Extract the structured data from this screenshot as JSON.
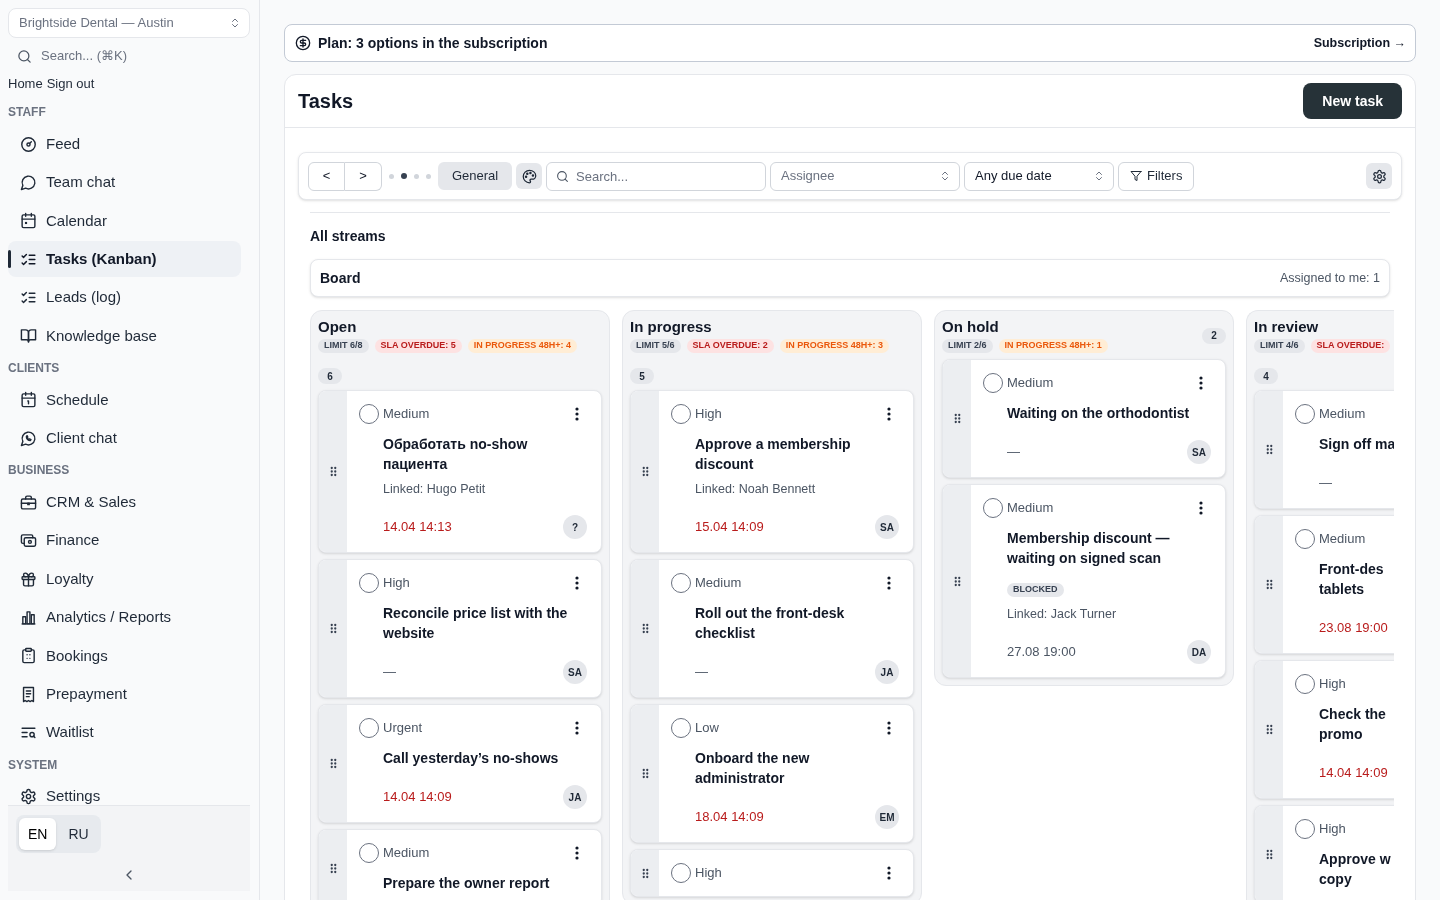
{
  "sidebar": {
    "org_select": {
      "value": "Brightside Dental — Austin"
    },
    "search": {
      "placeholder": "Search... (⌘K)"
    },
    "links": [
      "Home",
      "Sign out"
    ],
    "sections": [
      {
        "title": "STAFF",
        "items": [
          {
            "label": "Feed",
            "selected": false
          },
          {
            "label": "Team chat",
            "selected": false
          },
          {
            "label": "Calendar",
            "selected": false
          },
          {
            "label": "Tasks (Kanban)",
            "selected": true
          },
          {
            "label": "Leads (log)",
            "selected": false
          },
          {
            "label": "Knowledge base",
            "selected": false
          }
        ]
      },
      {
        "title": "CLIENTS",
        "items": [
          {
            "label": "Schedule",
            "selected": false
          },
          {
            "label": "Client chat",
            "selected": false
          }
        ]
      },
      {
        "title": "BUSINESS",
        "items": [
          {
            "label": "CRM & Sales",
            "selected": false
          },
          {
            "label": "Finance",
            "selected": false
          },
          {
            "label": "Loyalty",
            "selected": false
          },
          {
            "label": "Analytics / Reports",
            "selected": false
          },
          {
            "label": "Bookings",
            "selected": false
          },
          {
            "label": "Prepayment",
            "selected": false
          },
          {
            "label": "Waitlist",
            "selected": false
          }
        ]
      },
      {
        "title": "SYSTEM",
        "items": [
          {
            "label": "Settings",
            "selected": false
          }
        ]
      }
    ],
    "languages": [
      {
        "label": "EN",
        "selected": true
      },
      {
        "label": "RU",
        "selected": false
      }
    ]
  },
  "plan_banner": {
    "text": "Plan: 3 options in the subscription",
    "link": "Subscription →"
  },
  "header": {
    "title": "Tasks",
    "new_button": "New task"
  },
  "toolbar": {
    "prev": "<",
    "next": ">",
    "pages": [
      {
        "selected": false
      },
      {
        "selected": true
      },
      {
        "selected": false
      },
      {
        "selected": false
      }
    ],
    "stream": "General",
    "search": {
      "placeholder": "Search..."
    },
    "assignee": {
      "placeholder": "Assignee"
    },
    "due_date": {
      "value": "Any due date"
    },
    "filters": "Filters"
  },
  "streams_title": "All streams",
  "board": {
    "title": "Board",
    "assigned": "Assigned to me: 1"
  },
  "columns": [
    {
      "title": "Open",
      "clipped": false,
      "badges": [
        {
          "kind": "limit",
          "text": "LIMIT 6/8"
        },
        {
          "kind": "overdue",
          "text": "SLA OVERDUE: 5"
        },
        {
          "kind": "stale",
          "text": "IN PROGRESS 48H+: 4"
        }
      ],
      "count": "6",
      "cards": [
        {
          "priority": "Medium",
          "checked": false,
          "title": "Обработать no‑show пациента",
          "linked": "Linked: Hugo Petit",
          "due": "14.04 14:13",
          "overdue": true,
          "assignee": "?"
        },
        {
          "priority": "High",
          "checked": false,
          "title": "Reconcile price list with the website",
          "due": "—",
          "overdue": false,
          "assignee": "SA"
        },
        {
          "priority": "Urgent",
          "checked": false,
          "title": "Call yesterday’s no‑shows",
          "due": "14.04 14:09",
          "overdue": true,
          "assignee": "JA"
        },
        {
          "priority": "Medium",
          "checked": false,
          "title": "Prepare the owner report"
        }
      ]
    },
    {
      "title": "In progress",
      "clipped": false,
      "badges": [
        {
          "kind": "limit",
          "text": "LIMIT 5/6"
        },
        {
          "kind": "overdue",
          "text": "SLA OVERDUE: 2"
        },
        {
          "kind": "stale",
          "text": "IN PROGRESS 48H+: 3"
        }
      ],
      "count": "5",
      "cards": [
        {
          "priority": "High",
          "checked": false,
          "title": "Approve a membership discount",
          "linked": "Linked: Noah Bennett",
          "due": "15.04 14:09",
          "overdue": true,
          "assignee": "SA"
        },
        {
          "priority": "Medium",
          "checked": false,
          "title": "Roll out the front‑desk checklist",
          "due": "—",
          "overdue": false,
          "assignee": "JA"
        },
        {
          "priority": "Low",
          "checked": false,
          "title": "Onboard the new administrator",
          "due": "18.04 14:09",
          "overdue": true,
          "assignee": "EM"
        },
        {
          "priority": "High",
          "checked": false
        }
      ]
    },
    {
      "title": "On hold",
      "clipped": false,
      "badges": [
        {
          "kind": "limit",
          "text": "LIMIT 2/6"
        },
        {
          "kind": "stale",
          "text": "IN PROGRESS 48H+: 1"
        }
      ],
      "count": "2",
      "cards": [
        {
          "priority": "Medium",
          "checked": false,
          "title": "Waiting on the orthodontist",
          "due": "—",
          "overdue": false,
          "assignee": "SA"
        },
        {
          "priority": "Medium",
          "checked": false,
          "title": "Membership discount — waiting on signed scan",
          "tag": "BLOCKED",
          "linked": "Linked: Jack Turner",
          "due": "27.08 19:00",
          "overdue": false,
          "assignee": "DA"
        }
      ]
    },
    {
      "title": "In review",
      "clipped": true,
      "badges": [
        {
          "kind": "limit",
          "text": "LIMIT 4/6"
        },
        {
          "kind": "overdue",
          "text": "SLA OVERDUE:"
        }
      ],
      "count": "4",
      "cards": [
        {
          "priority": "Medium",
          "checked": false,
          "title": "Sign off ma",
          "due": "—",
          "overdue": false
        },
        {
          "priority": "Medium",
          "checked": false,
          "title": "Front‑des\ntablets",
          "due": "23.08 19:00",
          "overdue": true
        },
        {
          "priority": "High",
          "checked": false,
          "title": "Check the\npromo",
          "due": "14.04 14:09",
          "overdue": true
        },
        {
          "priority": "High",
          "checked": false,
          "title": "Approve w\ncopy"
        }
      ]
    }
  ]
}
